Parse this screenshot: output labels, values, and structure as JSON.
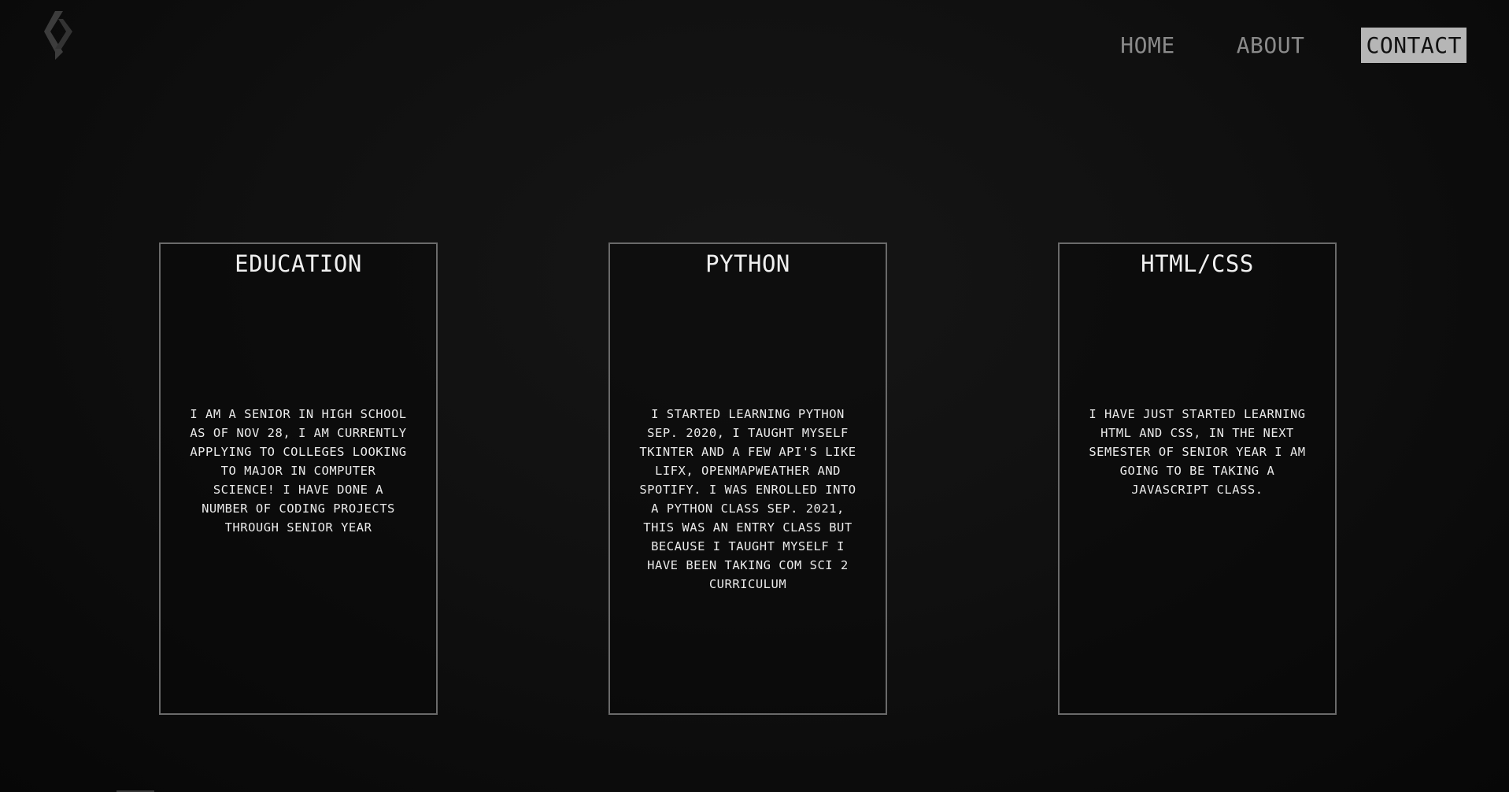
{
  "header": {
    "logo_icon": "angle-bracket-logo-icon",
    "nav": [
      {
        "label": "HOME",
        "active": false
      },
      {
        "label": "ABOUT",
        "active": false
      },
      {
        "label": "CONTACT",
        "active": true
      }
    ]
  },
  "cards": [
    {
      "title": "EDUCATION",
      "body": "I AM A SENIOR IN HIGH SCHOOL AS OF NOV 28, I AM CURRENTLY APPLYING TO COLLEGES LOOKING TO MAJOR IN COMPUTER SCIENCE! I HAVE DONE A NUMBER OF CODING PROJECTS THROUGH SENIOR YEAR"
    },
    {
      "title": "PYTHON",
      "body": "I STARTED LEARNING PYTHON SEP. 2020, I TAUGHT MYSELF TKINTER AND A FEW API'S LIKE LIFX, OPENMAPWEATHER AND SPOTIFY. I WAS ENROLLED INTO A PYTHON CLASS SEP. 2021, THIS WAS AN ENTRY CLASS BUT BECAUSE I TAUGHT MYSELF I HAVE BEEN TAKING COM SCI 2 CURRICULUM"
    },
    {
      "title": "HTML/CSS",
      "body": "I HAVE JUST STARTED LEARNING HTML AND CSS, IN THE NEXT SEMESTER OF SENIOR YEAR I AM GOING TO BE TAKING A JAVASCRIPT CLASS."
    }
  ],
  "colors": {
    "background": "#0f0f0f",
    "card_border": "#6a6a6a",
    "nav_inactive": "#8a8a8a",
    "nav_active_bg": "#b6b6b6",
    "logo": "#3c3c3c"
  }
}
